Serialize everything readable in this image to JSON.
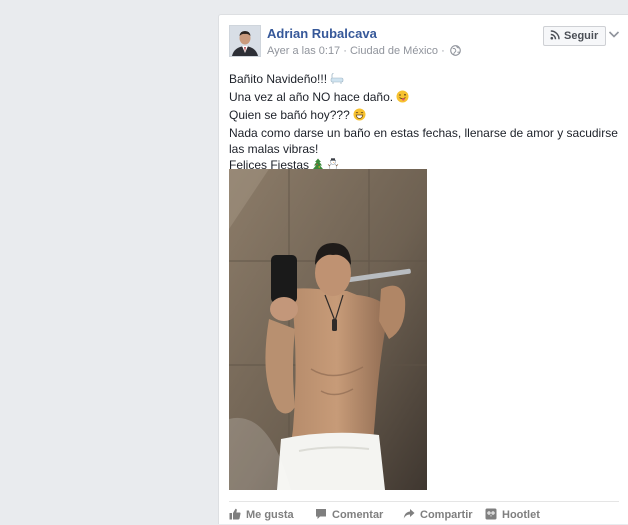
{
  "post": {
    "author": "Adrian Rubalcava",
    "time": "Ayer a las 0:17",
    "location": "Ciudad de México",
    "follow_label": "Seguir",
    "lines": [
      "Bañito Navideño!!!",
      "Una vez al año NO hace daño.",
      "Quien se bañó hoy???",
      "Nada como darse un baño en estas fechas, llenarse de amor y sacudirse las malas vibras!",
      "Felices Fiestas"
    ],
    "emojis": [
      "bathtub-icon",
      "winking-tongue-face-icon",
      "grinning-face-icon",
      "christmas-tree-icon",
      "snowman-icon"
    ]
  },
  "actions": {
    "like": "Me gusta",
    "comment": "Comentar",
    "share": "Compartir",
    "hootlet": "Hootlet"
  },
  "colors": {
    "background": "#e9ebee",
    "author_link": "#365899",
    "meta_text": "#90949c",
    "action_text": "#7f7f7f"
  }
}
